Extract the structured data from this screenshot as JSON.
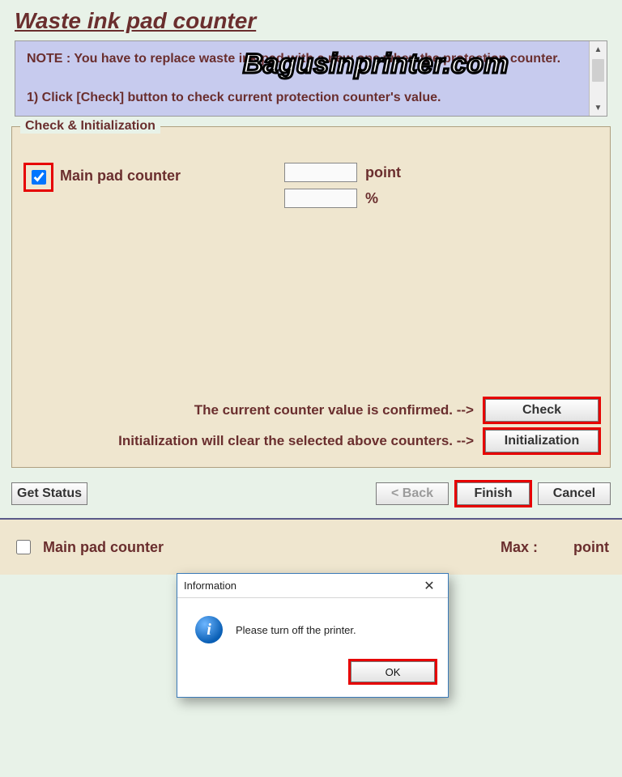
{
  "title": "Waste ink pad counter",
  "watermark": "Bagusinprinter.com",
  "info_note": "NOTE : You have to replace waste ink pad with a new one when the protection counter.\n\n1) Click [Check] button to check current protection counter's value.",
  "group": {
    "legend": "Check & Initialization",
    "main_pad_label": "Main pad counter",
    "point_value": "",
    "point_unit": "point",
    "percent_value": "",
    "percent_unit": "%",
    "check_desc": "The current counter value is confirmed. -->",
    "init_desc": "Initialization will clear the selected above counters. -->",
    "check_btn": "Check",
    "init_btn": "Initialization"
  },
  "nav": {
    "get_status": "Get Status",
    "back": "< Back",
    "finish": "Finish",
    "cancel": "Cancel"
  },
  "lower": {
    "label": "Main pad counter",
    "max_label": "Max :",
    "max_unit": "point"
  },
  "dialog": {
    "title": "Information",
    "message": "Please turn off the printer.",
    "ok": "OK"
  }
}
